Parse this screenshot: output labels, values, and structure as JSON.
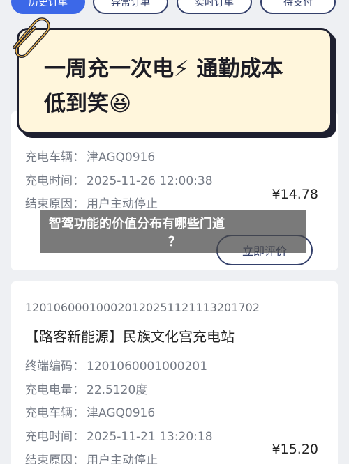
{
  "tabs": [
    {
      "label": "历史订单",
      "active": true
    },
    {
      "label": "异常订单",
      "active": false
    },
    {
      "label": "实时订单",
      "active": false
    },
    {
      "label": "待支付",
      "active": false
    }
  ],
  "banner": {
    "line1": "一周充一次电⚡ 通勤成本",
    "line2": "低到笑😆"
  },
  "orders": [
    {
      "vehicle_label": "充电车辆：",
      "vehicle": "津AGQ0916",
      "time_label": "充电时间：",
      "time": "2025-11-26 12:00:38",
      "end_reason_label": "结束原因：",
      "end_reason": "用户主动停止",
      "price": "¥14.78",
      "rate_button": "立即评价"
    },
    {
      "order_no": "120106000100020120251121113201702",
      "station": "【路客新能源】民族文化宫充电站",
      "terminal_label": "终端编码：",
      "terminal": "1201060001000201",
      "energy_label": "充电电量：",
      "energy": "22.5120度",
      "vehicle_label": "充电车辆：",
      "vehicle": "津AGQ0916",
      "time_label": "充电时间：",
      "time": "2025-11-21 13:20:18",
      "end_reason_label": "结束原因：",
      "end_reason": "用户主动停止",
      "price": "¥15.20"
    }
  ],
  "overlay": {
    "line1": "智驾功能的价值分布有哪些门道",
    "line2": "？"
  },
  "colors": {
    "accent": "#3c68e8",
    "navy": "#34406b",
    "banner_bg": "#fff6dc"
  },
  "icons": {
    "paperclip": "paperclip-icon"
  }
}
